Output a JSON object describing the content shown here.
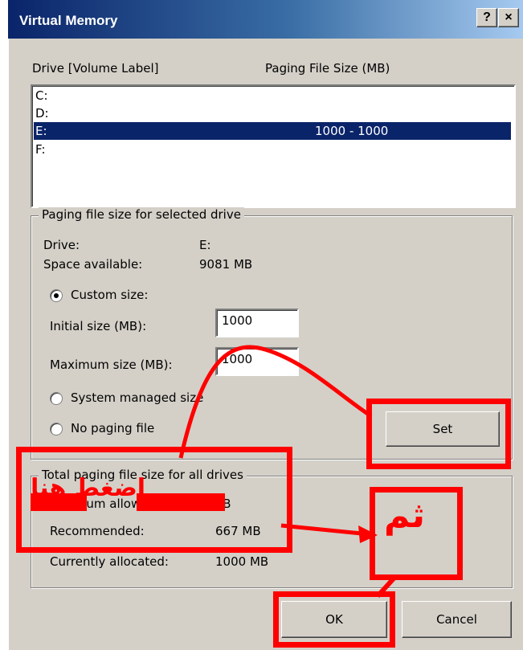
{
  "window": {
    "title": "Virtual Memory",
    "help_button": "?",
    "close_button": "×"
  },
  "drives_header": {
    "drive_label": "Drive  [Volume Label]",
    "size_label": "Paging File Size (MB)"
  },
  "drives": [
    {
      "drive": "C:",
      "size": "",
      "selected": false
    },
    {
      "drive": "D:",
      "size": "",
      "selected": false
    },
    {
      "drive": "E:",
      "size": "1000 - 1000",
      "selected": true
    },
    {
      "drive": "F:",
      "size": "",
      "selected": false
    }
  ],
  "selected_group": {
    "title": "Paging file size for selected drive",
    "drive_label": "Drive:",
    "drive_value": "E:",
    "space_label": "Space available:",
    "space_value": "9081 MB",
    "custom_size_label": "Custom size:",
    "initial_label": "Initial size (MB):",
    "initial_value": "1000",
    "maximum_label": "Maximum size (MB):",
    "maximum_value": "1000",
    "system_managed_label": "System managed size",
    "no_paging_label": "No paging file",
    "set_button": "Set"
  },
  "total_group": {
    "title": "Total paging file size for all drives",
    "minimum_label": "Minimum allowed:",
    "minimum_value": "2 MB",
    "recommended_label": "Recommended:",
    "recommended_value": "667 MB",
    "allocated_label": "Currently allocated:",
    "allocated_value": "1000 MB"
  },
  "buttons": {
    "ok": "OK",
    "cancel": "Cancel"
  },
  "annotations": {
    "press_here": "إضغط هنا",
    "then": "ثم",
    "color": "#ff0000"
  }
}
